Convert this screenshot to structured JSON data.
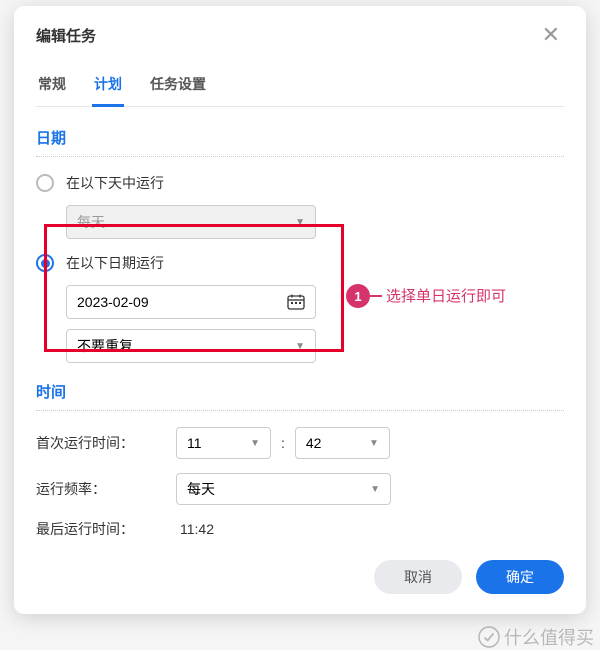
{
  "dialog": {
    "title": "编辑任务",
    "tabs": [
      "常规",
      "计划",
      "任务设置"
    ],
    "activeTab": 1
  },
  "date": {
    "sectionTitle": "日期",
    "option1": {
      "label": "在以下天中运行",
      "select": "每天"
    },
    "option2": {
      "label": "在以下日期运行",
      "value": "2023-02-09",
      "repeat": "不要重复"
    }
  },
  "time": {
    "sectionTitle": "时间",
    "firstRunLabel": "首次运行时间：",
    "hour": "11",
    "minute": "42",
    "colon": ":",
    "freqLabel": "运行频率：",
    "freqValue": "每天",
    "lastRunLabel": "最后运行时间：",
    "lastRunValue": "11:42"
  },
  "footer": {
    "cancel": "取消",
    "confirm": "确定"
  },
  "annotation": {
    "badge": "1",
    "text": "选择单日运行即可"
  },
  "watermark": "什么值得买"
}
